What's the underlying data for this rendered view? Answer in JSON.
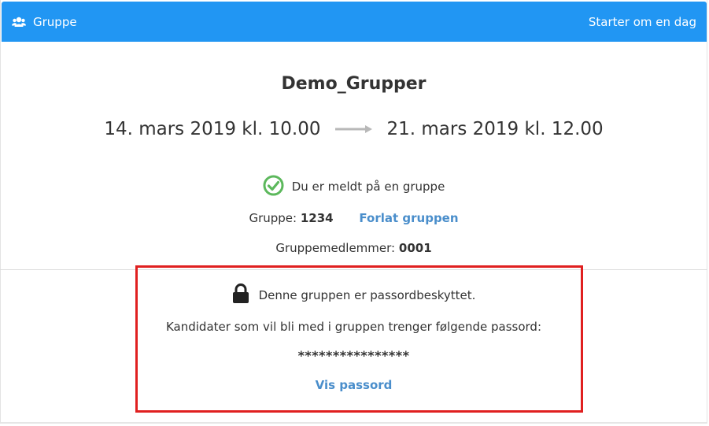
{
  "header": {
    "title": "Gruppe",
    "status": "Starter om en dag",
    "icon": "users-icon",
    "color": "#2196f3"
  },
  "event": {
    "title": "Demo_Grupper",
    "start": "14. mars 2019 kl. 10.00",
    "end": "21. mars 2019 kl. 12.00"
  },
  "registration": {
    "status": "Du er meldt på en gruppe",
    "group_label": "Gruppe:",
    "group_number": "1234",
    "leave_link": "Forlat gruppen",
    "members_label": "Gruppemedlemmer:",
    "members_value": "0001"
  },
  "password_section": {
    "protected_text": "Denne gruppen er passordbeskyttet.",
    "info_text": "Kandidater som vil bli med i gruppen trenger følgende passord:",
    "masked_password": "****************",
    "show_link": "Vis passord"
  },
  "colors": {
    "link": "#4a8ecb",
    "success": "#5cb85c",
    "highlight": "#e02020"
  }
}
